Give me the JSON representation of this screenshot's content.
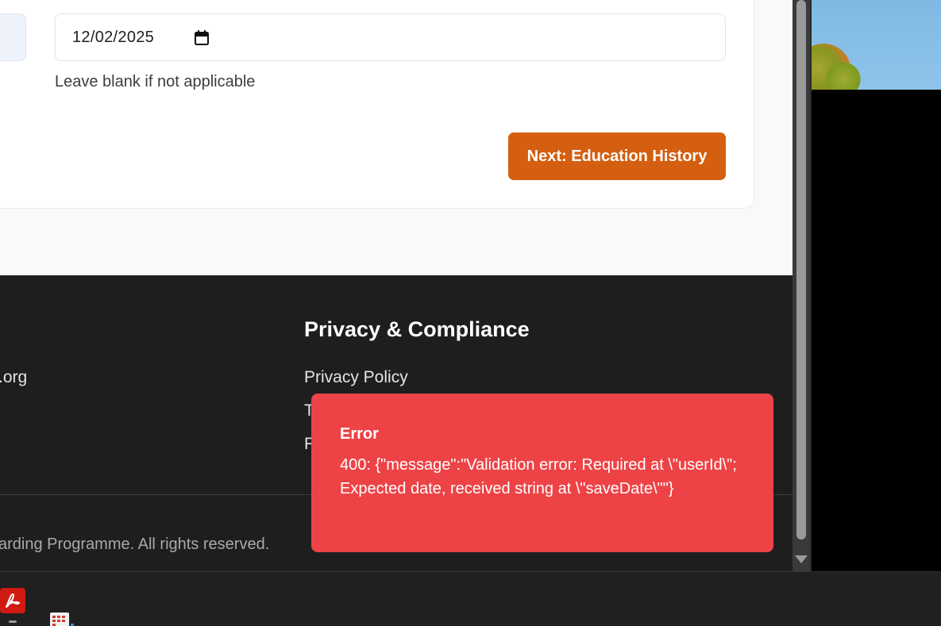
{
  "form": {
    "date_value": "12/02/2025",
    "helper_text": "Leave blank if not applicable",
    "next_button": "Next: Education History"
  },
  "footer": {
    "left_link_fragment": ".org",
    "privacy_heading": "Privacy & Compliance",
    "privacy_links": [
      "Privacy Policy",
      "T",
      "F"
    ],
    "copyright_fragment": "arding Programme. All rights reserved."
  },
  "toast": {
    "title": "Error",
    "message": "400: {\"message\":\"Validation error: Required at \\\"userId\\\"; Expected date, received string at \\\"saveDate\\\"\"}",
    "color": "#ee4346"
  },
  "colors": {
    "accent_button": "#d55f10",
    "footer_bg": "#1e1e1e",
    "page_bg": "#f9f9f9"
  },
  "taskbar": {
    "icons": [
      "pdf-reader-icon",
      "app-icon"
    ]
  }
}
